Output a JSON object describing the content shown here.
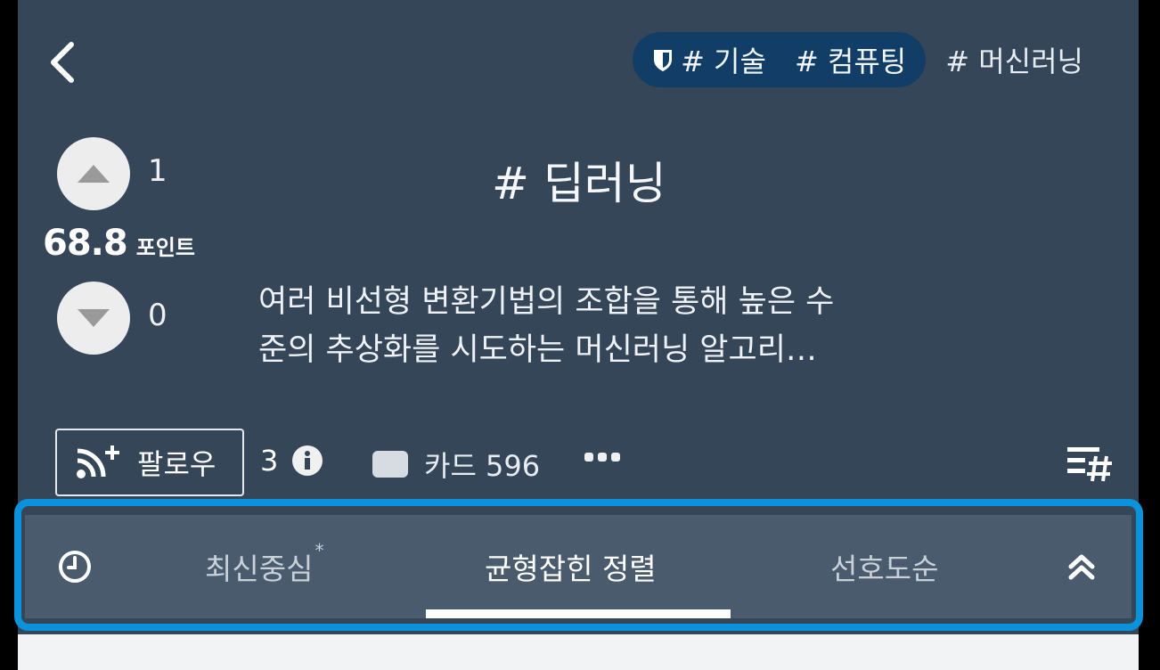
{
  "tags": [
    {
      "label": "# 기술",
      "icon": "shield-icon",
      "active": true
    },
    {
      "label": "# 컴퓨팅",
      "active": true
    },
    {
      "label": "# 머신러닝",
      "active": false
    }
  ],
  "topic": {
    "title": "# 딥러닝",
    "description_line1": "여러 비선형 변환기법의 조합을 통해 높은 수",
    "description_line2": "준의 추상화를 시도하는 머신러닝 알고리…"
  },
  "votes": {
    "up": "1",
    "down": "0",
    "points": "68.8",
    "points_unit": "포인트"
  },
  "actions": {
    "follow_label": "팔로우",
    "follow_count": "3",
    "card_label": "카드 596"
  },
  "sortbar": {
    "tabs": [
      {
        "label": "최신중심",
        "marker": "*"
      },
      {
        "label": "균형잡힌 정렬"
      },
      {
        "label": "선호도순"
      }
    ]
  },
  "colors": {
    "panel": "#354659",
    "sortbar": "#4a5b6d",
    "tag_active": "#123d66",
    "highlight": "#0a93dc"
  }
}
